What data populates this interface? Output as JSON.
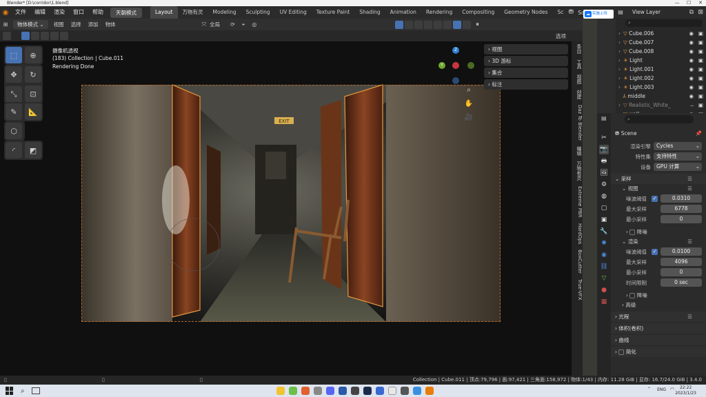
{
  "titlebar": {
    "title": "Blender* [D:\\corridor\\1.blend]",
    "minimize": "—",
    "maximize": "☐",
    "close": "✕"
  },
  "topmenu": {
    "items": [
      "文件",
      "编辑",
      "渲染",
      "窗口",
      "帮助"
    ],
    "mode": "天朝模式",
    "workspaces": [
      "Layout",
      "万物有灵",
      "Modeling",
      "Sculpting",
      "UV Editing",
      "Texture Paint",
      "Shading",
      "Animation",
      "Rendering",
      "Compositing",
      "Geometry Nodes",
      "Sc"
    ],
    "active_workspace": "Layout",
    "scene_label": "Scene",
    "cloud_btn": "实施上传",
    "view_layer": "View Layer"
  },
  "header2": {
    "object_mode": "物体模式",
    "menus": [
      "视图",
      "选择",
      "添加",
      "物体"
    ],
    "transform_orientation": "全局",
    "options": "选项"
  },
  "viewport": {
    "camera_label": "摄像机透视",
    "collection_label": "(183) Collection | Cube.011",
    "status_label": "Rendering Done",
    "exit_sign": "EXIT",
    "panels": [
      "视图",
      "3D 游标",
      "集合",
      "标注"
    ],
    "gizmo": {
      "x": "X",
      "y": "Y",
      "z": "Z"
    },
    "side_tabs": [
      "条目",
      "工具",
      "视图",
      "创建",
      "Daz To Blender",
      "编辑",
      "万物有灵",
      "Extreme PBR",
      "HardOps",
      "BoxCutter",
      "True-VFX"
    ]
  },
  "outliner": {
    "rows": [
      {
        "name": "Cube.006",
        "color": "#cfcfcf"
      },
      {
        "name": "Cube.007",
        "color": "#cfcfcf"
      },
      {
        "name": "Cube.008",
        "color": "#cfcfcf"
      },
      {
        "name": "Light",
        "color": "#cfcfcf"
      },
      {
        "name": "Light.001",
        "color": "#cfcfcf"
      },
      {
        "name": "Light.002",
        "color": "#cfcfcf"
      },
      {
        "name": "Light.003",
        "color": "#cfcfcf"
      },
      {
        "name": "middle",
        "color": "#cfcfcf"
      },
      {
        "name": "Realistic_White_",
        "color": "#888888"
      },
      {
        "name": "wall",
        "color": "#cfcfcf"
      }
    ]
  },
  "properties": {
    "scene_name": "Scene",
    "render_engine_label": "渲染引擎",
    "render_engine": "Cycles",
    "feature_set_label": "特性集",
    "feature_set": "支持特性",
    "device_label": "设备",
    "device": "GPU 计算",
    "sampling": "采样",
    "viewport_section": "视图",
    "noise_threshold_label": "噪波阈值",
    "vp_noise_threshold": "0.0310",
    "max_samples_label": "最大采样",
    "vp_max_samples": "6778",
    "min_samples_label": "最小采样",
    "vp_min_samples": "0",
    "denoise": "降噪",
    "render_section": "渲染",
    "r_noise_threshold": "0.0100",
    "r_max_samples": "4096",
    "r_min_samples": "0",
    "time_limit_label": "时间限制",
    "time_limit": "0 sec",
    "advanced": "高级",
    "light_paths": "光程",
    "volumes": "体积(卷积)",
    "curves": "曲线",
    "simplify": "简化"
  },
  "statusbar": {
    "stats": "Collection | Cube.011 | 顶点:79,796 | 面:97,421 | 三角面:158,972 | 物体:1/43 | 内存: 11.28 GiB | 显存: 16.7/24.0 GiB | 3.4.0"
  },
  "taskbar": {
    "lang": "ENG",
    "time": "22:22",
    "date": "2023/1/23"
  }
}
